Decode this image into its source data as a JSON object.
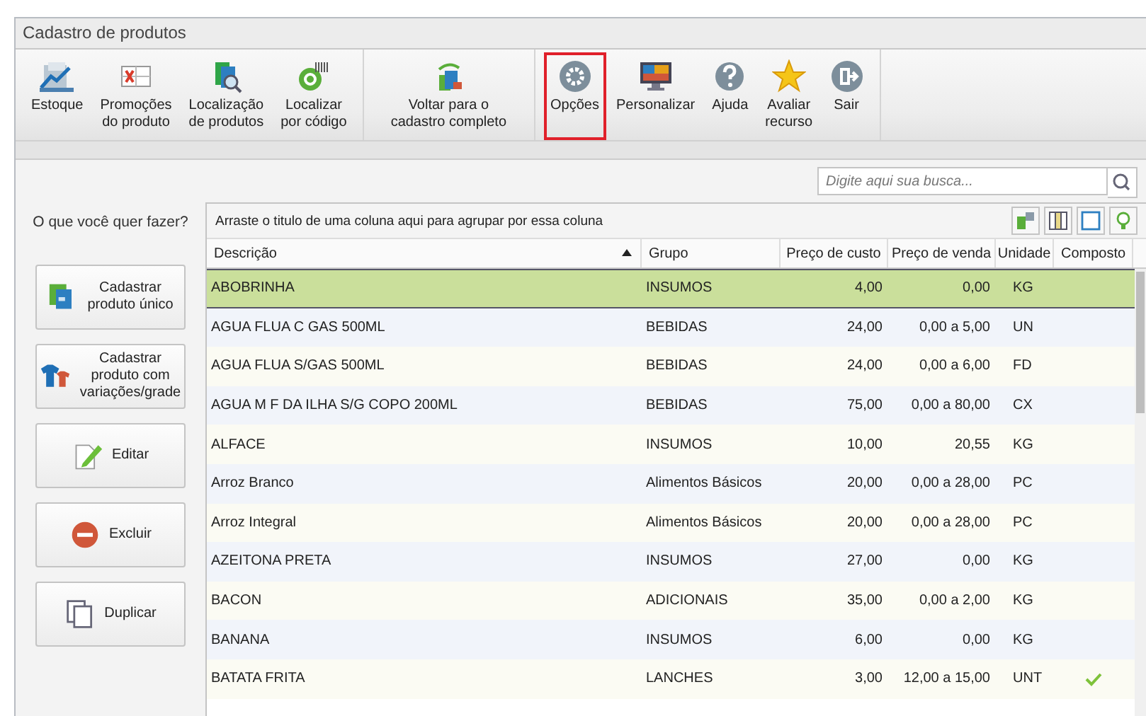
{
  "window": {
    "title": "Cadastro de produtos"
  },
  "ribbon": {
    "groups": [
      {
        "buttons": [
          {
            "label": "Estoque",
            "highlighted": false
          },
          {
            "label": "Promoções\ndo produto",
            "highlighted": false
          },
          {
            "label": "Localização\nde produtos",
            "highlighted": false
          },
          {
            "label": "Localizar\npor código",
            "highlighted": false
          }
        ]
      },
      {
        "buttons": [
          {
            "label": "Voltar para o\ncadastro completo",
            "highlighted": false
          }
        ]
      },
      {
        "buttons": [
          {
            "label": "Opções",
            "highlighted": true
          },
          {
            "label": "Personalizar",
            "highlighted": false
          },
          {
            "label": "Ajuda",
            "highlighted": false
          },
          {
            "label": "Avaliar\nrecurso",
            "highlighted": false
          },
          {
            "label": "Sair",
            "highlighted": false
          }
        ]
      }
    ]
  },
  "search": {
    "placeholder": "Digite aqui sua busca..."
  },
  "sidebar": {
    "prompt": "O que você quer fazer?",
    "buttons": [
      "Cadastrar\nproduto único",
      "Cadastrar\nproduto com\nvariações/grade",
      "Editar",
      "Excluir",
      "Duplicar"
    ]
  },
  "table": {
    "group_hint": "Arraste o titulo de uma coluna aqui para agrupar por essa coluna",
    "columns": [
      {
        "label": "Descrição",
        "sorted": true
      },
      {
        "label": "Grupo",
        "sorted": false
      },
      {
        "label": "Preço de custo",
        "sorted": false
      },
      {
        "label": "Preço de venda",
        "sorted": false
      },
      {
        "label": "Unidade",
        "sorted": false
      },
      {
        "label": "Composto",
        "sorted": false
      }
    ],
    "rows": [
      {
        "descricao": "ABOBRINHA",
        "grupo": "INSUMOS",
        "custo": "4,00",
        "venda": "0,00",
        "unidade": "KG",
        "composto": false,
        "selected": true
      },
      {
        "descricao": "AGUA FLUA C GAS 500ML",
        "grupo": "BEBIDAS",
        "custo": "24,00",
        "venda": "0,00 a 5,00",
        "unidade": "UN",
        "composto": false,
        "selected": false
      },
      {
        "descricao": "AGUA FLUA S/GAS 500ML",
        "grupo": "BEBIDAS",
        "custo": "24,00",
        "venda": "0,00 a 6,00",
        "unidade": "FD",
        "composto": false,
        "selected": false
      },
      {
        "descricao": "AGUA M F DA ILHA S/G COPO 200ML",
        "grupo": "BEBIDAS",
        "custo": "75,00",
        "venda": "0,00 a 80,00",
        "unidade": "CX",
        "composto": false,
        "selected": false
      },
      {
        "descricao": "ALFACE",
        "grupo": "INSUMOS",
        "custo": "10,00",
        "venda": "20,55",
        "unidade": "KG",
        "composto": false,
        "selected": false
      },
      {
        "descricao": "Arroz Branco",
        "grupo": "Alimentos Básicos",
        "custo": "20,00",
        "venda": "0,00 a 28,00",
        "unidade": "PC",
        "composto": false,
        "selected": false
      },
      {
        "descricao": "Arroz Integral",
        "grupo": "Alimentos Básicos",
        "custo": "20,00",
        "venda": "0,00 a 28,00",
        "unidade": "PC",
        "composto": false,
        "selected": false
      },
      {
        "descricao": "AZEITONA PRETA",
        "grupo": "INSUMOS",
        "custo": "27,00",
        "venda": "0,00",
        "unidade": "KG",
        "composto": false,
        "selected": false
      },
      {
        "descricao": "BACON",
        "grupo": "ADICIONAIS",
        "custo": "35,00",
        "venda": "0,00 a 2,00",
        "unidade": "KG",
        "composto": false,
        "selected": false
      },
      {
        "descricao": "BANANA",
        "grupo": "INSUMOS",
        "custo": "6,00",
        "venda": "0,00",
        "unidade": "KG",
        "composto": false,
        "selected": false
      },
      {
        "descricao": "BATATA FRITA",
        "grupo": "LANCHES",
        "custo": "3,00",
        "venda": "12,00 a 15,00",
        "unidade": "UNT",
        "composto": true,
        "selected": false
      }
    ]
  }
}
